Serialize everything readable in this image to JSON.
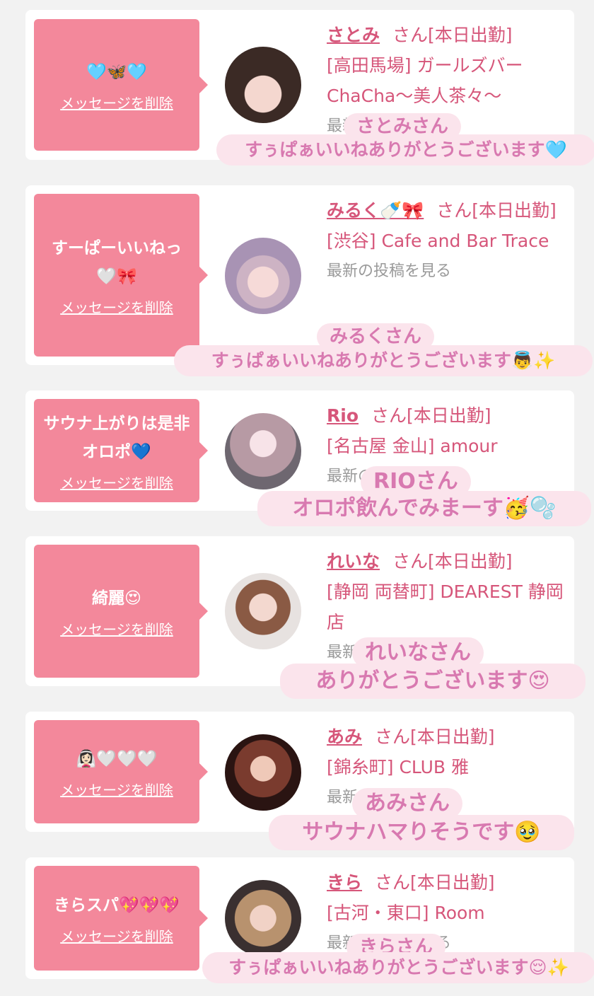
{
  "delete_label": "メッセージを削除",
  "suffix": "さん[本日出勤]",
  "more_label": "最新の投稿を見る",
  "cards": [
    {
      "message": "🩵🦋🩵",
      "name": "さとみ",
      "shop": "[高田馬場] ガールズバーChaCha〜美人茶々〜",
      "caption_name": "さとみさん",
      "caption_text": "すぅぱぁいいねありがとうございます🩵"
    },
    {
      "message": "すーぱーいいねっ🤍🎀",
      "name": "みるく🍼🎀",
      "shop": "[渋谷] Cafe and Bar Trace",
      "caption_name": "みるくさん",
      "caption_text": "すぅぱぁいいねありがとうございます👼✨"
    },
    {
      "message": "サウナ上がりは是非オロポ💙",
      "name": "Rio",
      "shop": "[名古屋 金山] amour",
      "caption_name": "RIOさん",
      "caption_text": "オロポ飲んでみまーす🥳🫧"
    },
    {
      "message": "綺麗😍",
      "name": "れいな",
      "shop": "[静岡 両替町] DEAREST 静岡店",
      "caption_name": "れいなさん",
      "caption_text": "ありがとうございます😍"
    },
    {
      "message": "👰🏻‍♀️🤍🤍🤍",
      "name": "あみ",
      "shop": "[錦糸町] CLUB 雅",
      "caption_name": "あみさん",
      "caption_text": "サウナハマりそうです🥹"
    },
    {
      "message": "きらスパ💖💖💖",
      "name": "きら",
      "shop": "[古河・東口] Room",
      "caption_name": "きらさん",
      "caption_text": "すぅぱぁいいねありがとうございます😌✨"
    }
  ]
}
